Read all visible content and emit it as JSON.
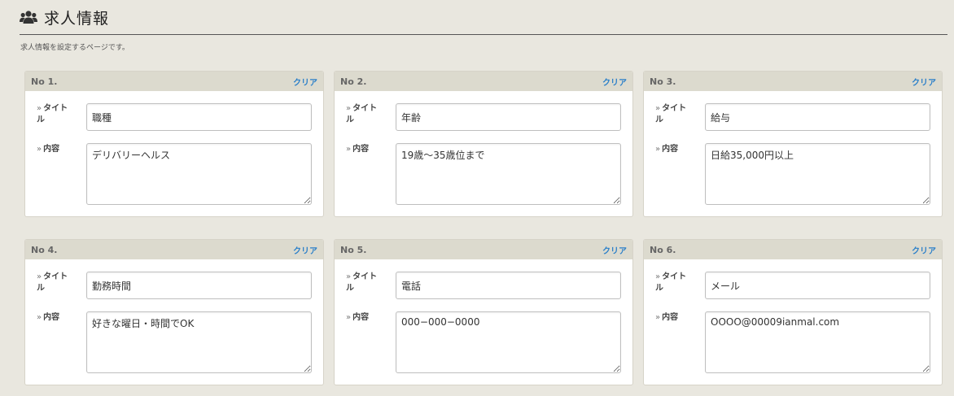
{
  "page": {
    "title": "求人情報",
    "description": "求人情報を設定するページです。",
    "header_icon": "users-icon"
  },
  "labels": {
    "title_label": "タイトル",
    "content_label": "内容",
    "clear_label": "クリア"
  },
  "cards": [
    {
      "no": "No 1.",
      "title": "職種",
      "content": "デリバリーヘルス"
    },
    {
      "no": "No 2.",
      "title": "年齢",
      "content": "19歳〜35歳位まで"
    },
    {
      "no": "No 3.",
      "title": "給与",
      "content": "日給35,000円以上"
    },
    {
      "no": "No 4.",
      "title": "勤務時間",
      "content": "好きな曜日・時間でOK"
    },
    {
      "no": "No 5.",
      "title": "電話",
      "content": "000−000−0000"
    },
    {
      "no": "No 6.",
      "title": "メール",
      "content": "OOOO@00009ianmal.com"
    }
  ],
  "colors": {
    "background": "#e9e7df",
    "card_header": "#dcdace",
    "link": "#2a7fc9"
  }
}
